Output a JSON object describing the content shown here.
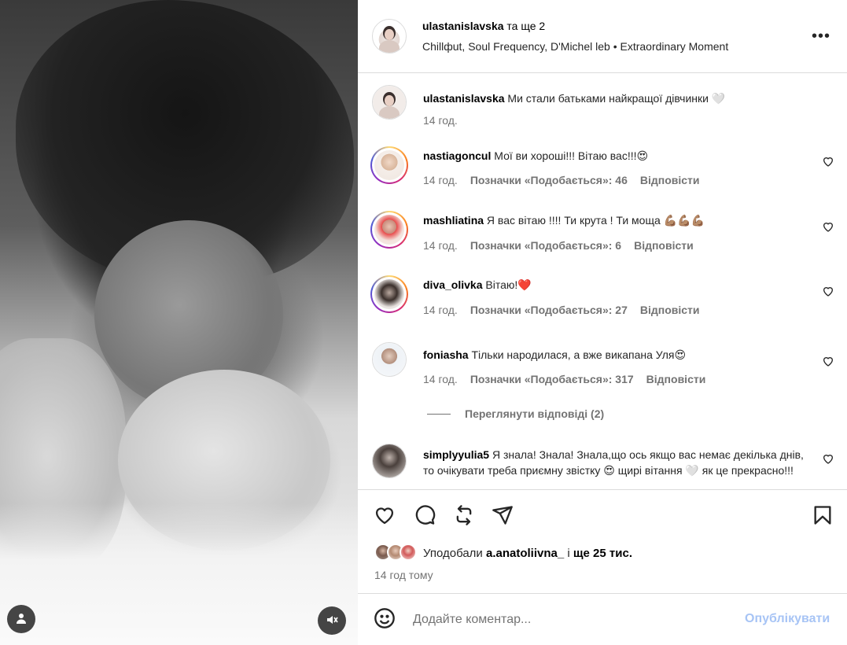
{
  "header": {
    "username": "ulastanislavska",
    "extra": "та ще 2",
    "music_artists": "Chillфut, Soul Frequency, D'Michel leb",
    "music_sep": "•",
    "music_track": "Extraordinary Moment",
    "more_label": "•••"
  },
  "caption": {
    "username": "ulastanislavska",
    "text": "Ми стали батьками найкращої дівчинки 🤍",
    "time": "14 год."
  },
  "comments": [
    {
      "username": "nastiagoncul",
      "text": "Мої ви хороші!!! Вітаю вас!!!😍",
      "time": "14 год.",
      "likes": "Позначки «Подобається»: 46",
      "reply": "Відповісти"
    },
    {
      "username": "mashliatina",
      "text": "Я вас вітаю !!!! Ти крута ! Ти моща 💪🏽💪🏽💪🏽",
      "time": "14 год.",
      "likes": "Позначки «Подобається»: 6",
      "reply": "Відповісти"
    },
    {
      "username": "diva_olivka",
      "text": "Вітаю!❤️",
      "time": "14 год.",
      "likes": "Позначки «Подобається»: 27",
      "reply": "Відповісти"
    },
    {
      "username": "foniasha",
      "text": "Тільки народилася, а вже викапана Уля😍",
      "time": "14 год.",
      "likes": "Позначки «Подобається»: 317",
      "reply": "Відповісти"
    },
    {
      "username": "simplyyulia5",
      "text": "Я знала! Знала! Знала,що ось якщо вас немає декілька днів, то очікувати треба приємну звістку 😍 щирі вітання 🤍 як це прекрасно!!!"
    }
  ],
  "view_replies": "Переглянути відповіді (2)",
  "likes": {
    "prefix": "Уподобали",
    "user": "a.anatoliivna_",
    "mid": "і",
    "count": "ще 25 тис."
  },
  "post_time": "14 год тому",
  "add_comment": {
    "placeholder": "Додайте коментар...",
    "publish_label": "Опублікувати"
  },
  "icons": {
    "like": "heart-icon",
    "comment": "comment-icon",
    "share": "repost-icon",
    "send": "send-icon",
    "save": "bookmark-icon",
    "emoji": "emoji-icon",
    "mute": "mute-icon",
    "user": "user-icon"
  },
  "colors": {
    "publish_disabled": "#a7c4f5",
    "secondary_text": "#737373",
    "divider": "#dbdbdb"
  }
}
